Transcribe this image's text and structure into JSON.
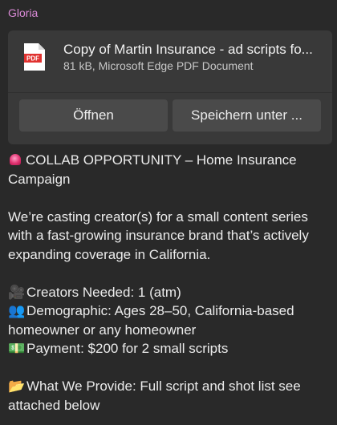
{
  "sender": "Gloria",
  "attachment": {
    "icon": "pdf-file-icon",
    "icon_label": "PDF",
    "file_name": "Copy of Martin Insurance - ad scripts fo...",
    "file_meta": "81 kB, Microsoft Edge PDF Document",
    "open_label": "Öffnen",
    "save_label": "Speichern unter ..."
  },
  "message": {
    "headline": "COLLAB OPPORTUNITY – Home Insurance Campaign",
    "intro": "We’re casting creator(s) for a small content series with a fast-growing insurance brand that’s actively expanding coverage in California.",
    "creators": "Creators Needed: 1 (atm)",
    "demographic": "Demographic: Ages 28–50, California-based homeowner or any homeowner",
    "payment": "Payment: $200 for 2 small scripts",
    "provide": "What We Provide: Full script and shot list see attached below"
  },
  "emojis": {
    "headline": "siren",
    "creators": "🎥",
    "demographic": "👥",
    "payment": "💵",
    "provide": "📂"
  }
}
